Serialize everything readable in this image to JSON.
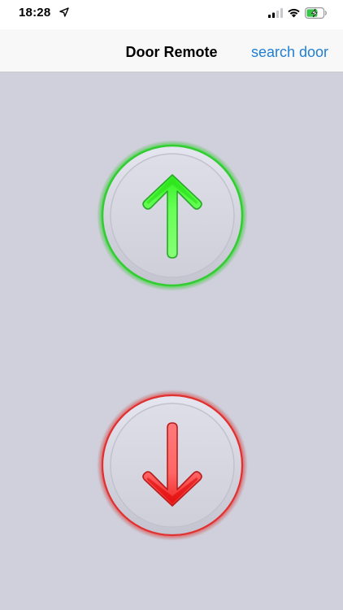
{
  "status_bar": {
    "time": "18:28",
    "icons": [
      "location-arrow-icon",
      "cellular-signal-icon",
      "wifi-icon",
      "battery-charging-icon"
    ],
    "battery_color": "#3ac34a"
  },
  "nav": {
    "title": "Door Remote",
    "action_label": "search door",
    "action_color": "#1f7ed6"
  },
  "background_color": "#d0d0dc",
  "buttons": {
    "up": {
      "icon": "arrow-up-icon",
      "ring_color": "#44dd44",
      "arrow_color": "#66ff55"
    },
    "down": {
      "icon": "arrow-down-icon",
      "ring_color": "#ee3333",
      "arrow_color": "#ff6666"
    }
  }
}
